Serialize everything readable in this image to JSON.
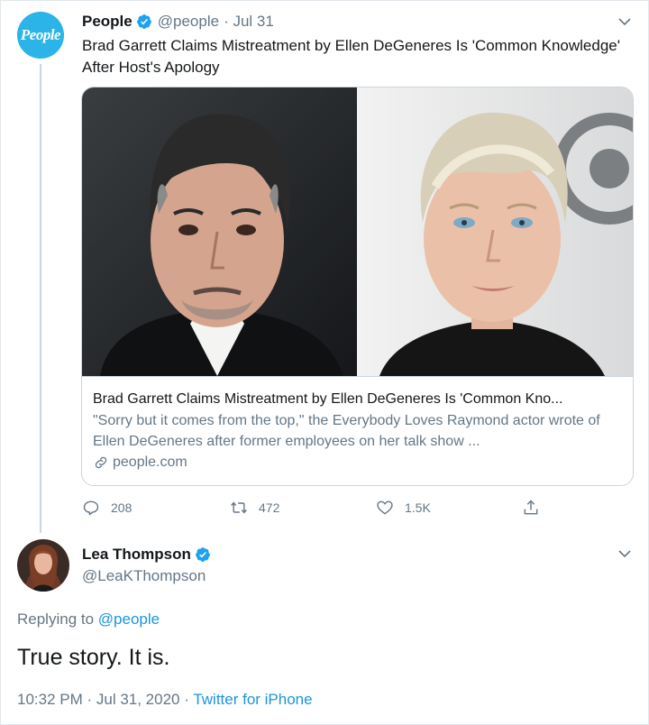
{
  "tweet1": {
    "avatar_text": "People",
    "name": "People",
    "handle": "@people",
    "date": "· Jul 31",
    "text": "Brad Garrett Claims Mistreatment by Ellen DeGeneres Is 'Common Knowledge' After Host's Apology",
    "card": {
      "title": "Brad Garrett Claims Mistreatment by Ellen DeGeneres Is 'Common Kno...",
      "description": "\"Sorry but it comes from the top,\" the Everybody Loves Raymond actor wrote of Ellen DeGeneres after former employees on her talk show ...",
      "domain": "people.com"
    },
    "actions": {
      "replies": "208",
      "retweets": "472",
      "likes": "1.5K"
    }
  },
  "tweet2": {
    "name": "Lea Thompson",
    "handle": "@LeaKThompson",
    "replying_prefix": "Replying to",
    "replying_to": "@people",
    "text": "True story. It is.",
    "timestamp": "10:32 PM · Jul 31, 2020 · ",
    "source": "Twitter for iPhone"
  },
  "colors": {
    "link": "#1b95e0",
    "muted": "#657786",
    "verified": "#1da1f2",
    "people_brand": "#2bb4e8"
  }
}
